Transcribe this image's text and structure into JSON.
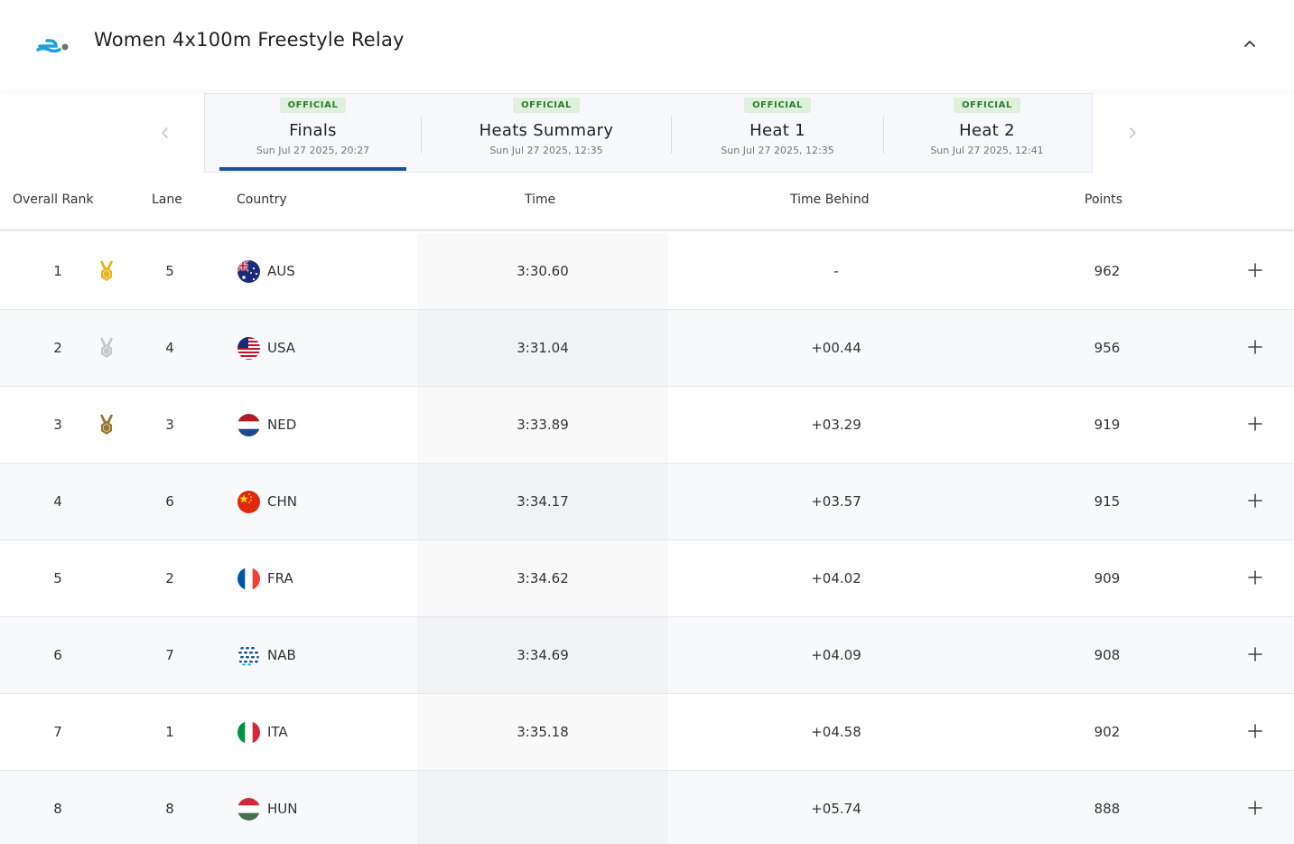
{
  "event": {
    "title": "Women 4x100m Freestyle Relay",
    "icon": "swimmer-icon",
    "collapse_icon": "chevron-up-icon"
  },
  "tabs": [
    {
      "status": "OFFICIAL",
      "name": "Finals",
      "date": "Sun Jul 27 2025, 20:27",
      "selected": true
    },
    {
      "status": "OFFICIAL",
      "name": "Heats Summary",
      "date": "Sun Jul 27 2025, 12:35",
      "selected": false
    },
    {
      "status": "OFFICIAL",
      "name": "Heat 1",
      "date": "Sun Jul 27 2025, 12:35",
      "selected": false
    },
    {
      "status": "OFFICIAL",
      "name": "Heat 2",
      "date": "Sun Jul 27 2025, 12:41",
      "selected": false
    }
  ],
  "table": {
    "columns": {
      "rank": "Overall Rank",
      "lane": "Lane",
      "country": "Country",
      "time": "Time",
      "behind": "Time Behind",
      "points": "Points"
    },
    "rows": [
      {
        "rank": "1",
        "medal": "gold",
        "lane": "5",
        "code": "AUS",
        "time": "3:30.60",
        "behind": "-",
        "points": "962"
      },
      {
        "rank": "2",
        "medal": "silver",
        "lane": "4",
        "code": "USA",
        "time": "3:31.04",
        "behind": "+00.44",
        "points": "956"
      },
      {
        "rank": "3",
        "medal": "bronze",
        "lane": "3",
        "code": "NED",
        "time": "3:33.89",
        "behind": "+03.29",
        "points": "919"
      },
      {
        "rank": "4",
        "medal": "",
        "lane": "6",
        "code": "CHN",
        "time": "3:34.17",
        "behind": "+03.57",
        "points": "915"
      },
      {
        "rank": "5",
        "medal": "",
        "lane": "2",
        "code": "FRA",
        "time": "3:34.62",
        "behind": "+04.02",
        "points": "909"
      },
      {
        "rank": "6",
        "medal": "",
        "lane": "7",
        "code": "NAB",
        "time": "3:34.69",
        "behind": "+04.09",
        "points": "908"
      },
      {
        "rank": "7",
        "medal": "",
        "lane": "1",
        "code": "ITA",
        "time": "3:35.18",
        "behind": "+04.58",
        "points": "902"
      },
      {
        "rank": "8",
        "medal": "",
        "lane": "8",
        "code": "HUN",
        "time": "",
        "behind": "+05.74",
        "points": "888"
      }
    ]
  },
  "colors": {
    "accent": "#1f4f9a",
    "official_bg": "#dff0dc",
    "official_text": "#2f7a2f",
    "gold": "#e8b21c",
    "silver": "#c4c7cc",
    "bronze": "#9a7433",
    "swim_icon": "#1aa3d9"
  }
}
